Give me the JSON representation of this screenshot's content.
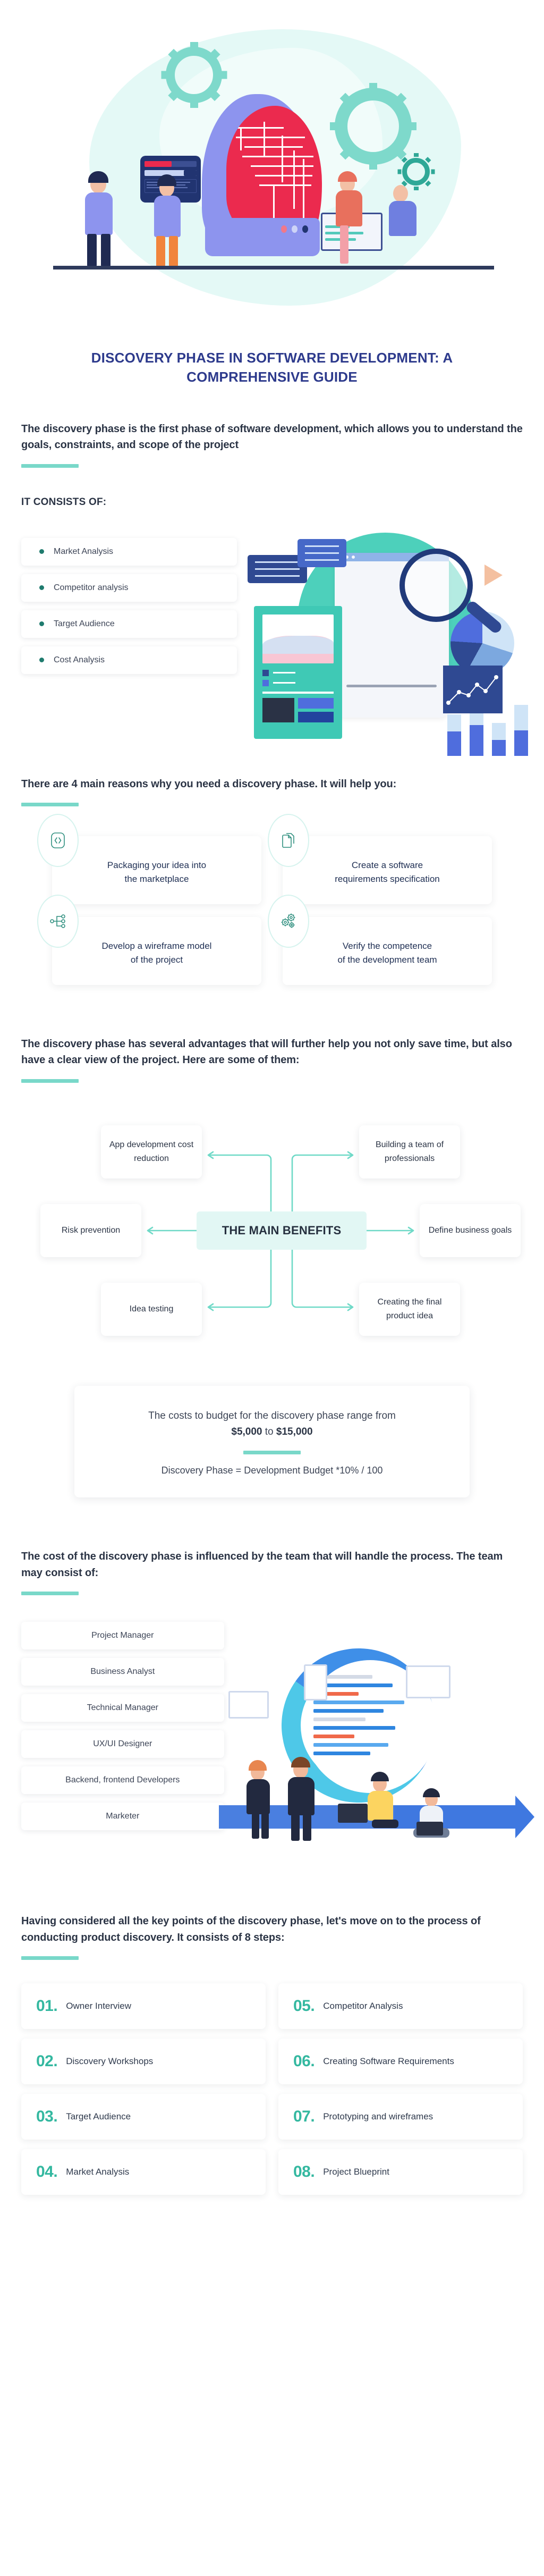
{
  "colors": {
    "brand_navy": "#2d3a8c",
    "accent_teal": "#79d8c9",
    "accent_green": "#34b8a0",
    "text_dark": "#2b3445",
    "body_text": "#3c4456",
    "benefit_core_bg": "#e2f7f4"
  },
  "hero": {
    "alt": "illustration of a human head profile with circuit-brain, gears, dashboard card and team of people at a desk",
    "icons": [
      "gear-icon",
      "gear-icon",
      "gear-icon",
      "brain-circuit-icon",
      "dashboard-card-icon",
      "monitor-icon",
      "laptop-icon"
    ]
  },
  "title": "DISCOVERY PHASE IN SOFTWARE DEVELOPMENT: A COMPREHENSIVE GUIDE",
  "intro": {
    "paragraph": "The discovery phase is the first phase of software development, which allows you to understand the goals, constraints, and scope of the project"
  },
  "consists": {
    "kicker": "IT CONSISTS OF:",
    "items": [
      "Market Analysis",
      "Competitor analysis",
      "Target Audience",
      "Cost Analysis"
    ],
    "illustration_alt": "analytics dashboard with pie chart, bar chart, magnifying glass and paper plane"
  },
  "reasons": {
    "heading": "There are 4 main reasons why you need a discovery phase. It will help you:",
    "cards": [
      {
        "icon": "code-brackets-icon",
        "text_line1": "Packaging your idea into",
        "text_line2": "the marketplace"
      },
      {
        "icon": "document-copy-icon",
        "text_line1": "Create a software",
        "text_line2": "requirements specification"
      },
      {
        "icon": "sitemap-icon",
        "text_line1": "Develop a wireframe model",
        "text_line2": "of the project"
      },
      {
        "icon": "gears-icon",
        "text_line1": "Verify the competence",
        "text_line2": "of the development team"
      }
    ]
  },
  "advantages": {
    "heading": "The discovery phase has several advantages that will further help you not only save time, but also have a clear view of the project. Here are some of them:",
    "core_label": "THE MAIN BENEFITS",
    "nodes": {
      "top_left": "App development cost reduction",
      "top_right": "Building a team of professionals",
      "mid_left": "Risk prevention",
      "mid_right": "Define business goals",
      "bottom_left": "Idea testing",
      "bottom_right": "Creating the final product idea"
    }
  },
  "cost": {
    "line1_prefix": "The costs to budget for the discovery phase range from",
    "range_low": "$5,000",
    "range_join": "to",
    "range_high": "$15,000",
    "formula": "Discovery Phase = Development Budget *10% / 100"
  },
  "team": {
    "heading": "The cost of the discovery phase is influenced by the team that will handle the process. The team may consist of:",
    "roles": [
      "Project Manager",
      "Business Analyst",
      "Technical Manager",
      "UX/UI Designer",
      "Backend, frontend Developers",
      "Marketer"
    ],
    "illustration_alt": "team of four people around a circular agile workflow arrow with screens and laptops"
  },
  "process": {
    "heading": "Having considered all the key points of the discovery phase, let's move on to the process of conducting product discovery. It consists of 8 steps:",
    "steps": [
      {
        "num": "01.",
        "label": "Owner Interview"
      },
      {
        "num": "02.",
        "label": "Discovery Workshops"
      },
      {
        "num": "03.",
        "label": "Target Audience"
      },
      {
        "num": "04.",
        "label": "Market Analysis"
      },
      {
        "num": "05.",
        "label": "Competitor Analysis"
      },
      {
        "num": "06.",
        "label": "Creating Software Requirements"
      },
      {
        "num": "07.",
        "label": "Prototyping and wireframes"
      },
      {
        "num": "08.",
        "label": "Project Blueprint"
      }
    ]
  }
}
